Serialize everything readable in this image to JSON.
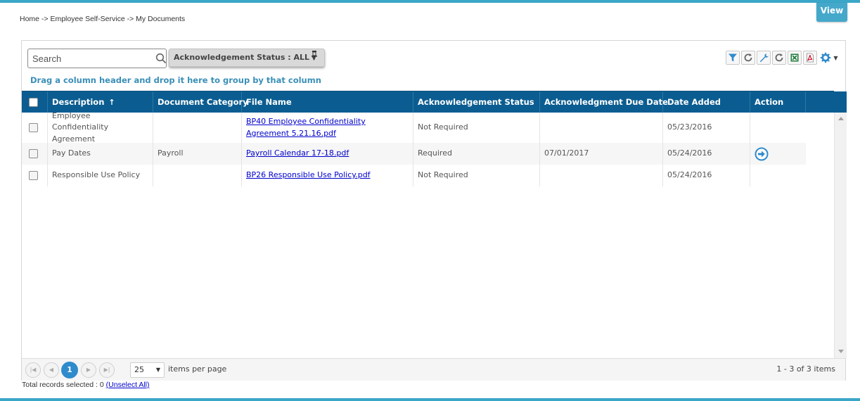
{
  "header": {
    "view_tab": "View",
    "breadcrumb": "Home -> Employee Self-Service -> My Documents"
  },
  "toolbar": {
    "search_placeholder": "Search",
    "ack_filter_label": "Acknowledgement Status : ALL",
    "group_hint": "Drag a column header and drop it here to group by that column",
    "icons": [
      "filter-icon",
      "refresh-icon",
      "wrench-icon",
      "refresh-icon",
      "excel-icon",
      "pdf-icon",
      "gear-icon"
    ]
  },
  "grid": {
    "columns": [
      "Description",
      "Document Category",
      "File Name",
      "Acknowledgement Status",
      "Acknowledgment Due Date",
      "Date Added",
      "Action"
    ],
    "sort_indicator": "↑",
    "rows": [
      {
        "description": "Employee Confidentiality Agreement",
        "category": "",
        "file_name": "BP40 Employee Confidentiality Agreement 5.21.16.pdf",
        "ack_status": "Not Required",
        "due_date": "",
        "date_added": "05/23/2016",
        "action": false
      },
      {
        "description": "Pay Dates",
        "category": "Payroll",
        "file_name": "Payroll Calendar 17-18.pdf",
        "ack_status": "Required",
        "due_date": "07/01/2017",
        "date_added": "05/24/2016",
        "action": true
      },
      {
        "description": "Responsible Use Policy",
        "category": "",
        "file_name": "BP26 Responsible Use Policy.pdf",
        "ack_status": "Not Required",
        "due_date": "",
        "date_added": "05/24/2016",
        "action": false
      }
    ]
  },
  "pager": {
    "current_page": "1",
    "page_size": "25",
    "items_per_page_label": "items per page",
    "info": "1 - 3 of 3 items"
  },
  "footer": {
    "selected_text": "Total records selected : 0",
    "unselect_link": "(Unselect All)"
  },
  "colors": {
    "accent": "#3aa6c8",
    "header_bg": "#0b5d91",
    "link": "#0000cc",
    "group_hint": "#3a8fb7",
    "page_active": "#2f8bcc"
  }
}
